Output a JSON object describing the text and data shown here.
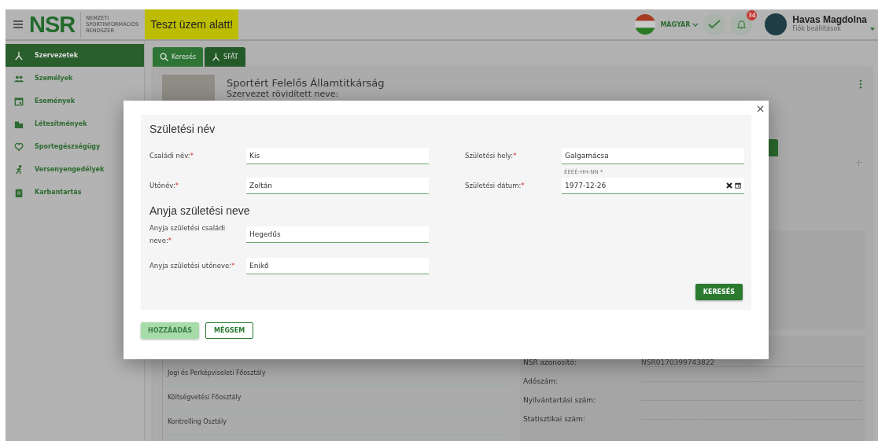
{
  "header": {
    "logo": "NSR",
    "logo_subtitle": [
      "NEMZETI",
      "SPORTINFORMÁCIÓS",
      "RENDSZER"
    ],
    "banner": "Teszt üzem alatt!",
    "language": "MAGYAR",
    "notification_count": "34",
    "user_name": "Havas Magdolna",
    "user_subtitle": "Fiók beállítások"
  },
  "sidebar": {
    "items": [
      {
        "label": "Szervezetek",
        "selected": true
      },
      {
        "label": "Személyek",
        "selected": false
      },
      {
        "label": "Események",
        "selected": false
      },
      {
        "label": "Létesítmények",
        "selected": false
      },
      {
        "label": "Sportegészségügy",
        "selected": false
      },
      {
        "label": "Versenyengedélyek",
        "selected": false
      },
      {
        "label": "Karbantartás",
        "selected": false
      }
    ]
  },
  "main": {
    "tabs": [
      {
        "label": "Keresés",
        "selected": false
      },
      {
        "label": "SFÁT",
        "selected": true
      }
    ],
    "org_title": "Sportért Felelős Államtitkárság",
    "org_subtitle": "Szervezet rövidített neve:",
    "units": [
      "Jogi és Perképviseleti Főosztály",
      "Költségvetési Főosztály",
      "Kontrolling Osztály"
    ],
    "info": [
      {
        "label": "NSR azonosító:",
        "value": "NSR0170399743822"
      },
      {
        "label": "Adószám:"
      },
      {
        "label": "Nyilvántartási szám:"
      },
      {
        "label": "Statisztikai szám:"
      }
    ]
  },
  "dialog": {
    "sections": [
      {
        "title": "Születési név",
        "fields": [
          {
            "label": "Családi név:",
            "required_mark": "*",
            "value": "Kis",
            "kind": "text"
          },
          {
            "label": "Utónév:",
            "required_mark": "*",
            "value": "Zoltán",
            "kind": "text"
          },
          {
            "label": "Születési hely:",
            "required_mark": "*",
            "value": "Galgamácsa",
            "kind": "text"
          },
          {
            "label": "Születési dátum:",
            "required_mark": "*",
            "value": "1977-12-26",
            "hint": "ÉÉÉÉ-HH-NN *",
            "kind": "date"
          }
        ]
      },
      {
        "title": "Anyja születési neve",
        "fields": [
          {
            "label": "Anyja születési családi neve:",
            "required_mark": "*",
            "value": "Hegedűs",
            "kind": "text"
          },
          {
            "label": "Anyja születési utóneve:",
            "required_mark": "*",
            "value": "Enikő",
            "kind": "text"
          }
        ]
      }
    ],
    "search_button": "KERESÉS",
    "add_button": {
      "label": "HOZZÁADÁS",
      "disabled": true
    },
    "cancel_button": "MÉGSEM"
  }
}
